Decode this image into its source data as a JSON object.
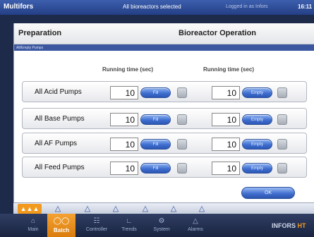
{
  "topbar": {
    "app_name": "Multifors",
    "selection": "All bioreactors selected",
    "login": "Logged in as Infors",
    "clock": "16:11"
  },
  "header": {
    "left": "Preparation",
    "title": "Bioreactor Operation",
    "breadcrumb": "All/Empty Pumps"
  },
  "columns": {
    "fill_head": "Running time (sec)",
    "empty_head": "Running time (sec)"
  },
  "rows": [
    {
      "label": "All Acid Pumps",
      "fill_value": "10",
      "fill_button": "Fill",
      "empty_value": "10",
      "empty_button": "Empty"
    },
    {
      "label": "All Base Pumps",
      "fill_value": "10",
      "fill_button": "Fill",
      "empty_value": "10",
      "empty_button": "Empty"
    },
    {
      "label": "All AF Pumps",
      "fill_value": "10",
      "fill_button": "Fill",
      "empty_value": "10",
      "empty_button": "Empty"
    },
    {
      "label": "All Feed Pumps",
      "fill_value": "10",
      "fill_button": "Fill",
      "empty_value": "10",
      "empty_button": "Empty"
    }
  ],
  "ok_label": "OK",
  "vessel_icon": "bioreactor-icon",
  "nav": {
    "items": [
      {
        "label": "Main",
        "icon": "home-icon"
      },
      {
        "label": "Batch",
        "icon": "batch-icon"
      },
      {
        "label": "Controller",
        "icon": "controller-icon"
      },
      {
        "label": "Trends",
        "icon": "trends-icon"
      },
      {
        "label": "System",
        "icon": "system-icon"
      },
      {
        "label": "Alarms",
        "icon": "alarm-icon"
      }
    ],
    "active": "Batch",
    "brand_a": "INFORS",
    "brand_b": "HT"
  },
  "colors": {
    "accent": "#f29a1e",
    "button_blue": "#3f6fd0",
    "topbar": "#2f4e9a"
  }
}
